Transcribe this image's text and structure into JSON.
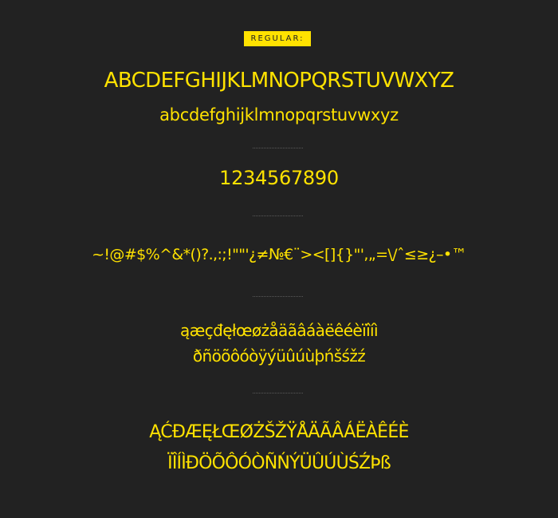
{
  "badge": "REGULAR:",
  "uppercase": "ABCDEFGHIJKLMNOPQRSTUVWXYZ",
  "lowercase": "abcdefghijklmnopqrstuvwxyz",
  "numerals": "1234567890",
  "symbols": "~!@#$%^&*()?.,:;!\"\"'¿≠№€¨><[]{}\"',„=\\/ˆ≤≥¿–•™",
  "accents_lower": [
    "ąæçđęłœøżåäãâáàëêéèïîíì",
    "ðñöõôóòÿýüûúùþńšśžź"
  ],
  "accents_upper": [
    "ĄĆĐÆĘŁŒØŻŠŽŸÅÄÃÂÁËÀÊÉÈ",
    "ÏÎÍÌÐÖÕÔÓÒÑŃÝÜÛÚÙŚŹÞß"
  ],
  "colors": {
    "background": "#222222",
    "accent": "#ffe200",
    "divider": "#5a5a5a"
  }
}
